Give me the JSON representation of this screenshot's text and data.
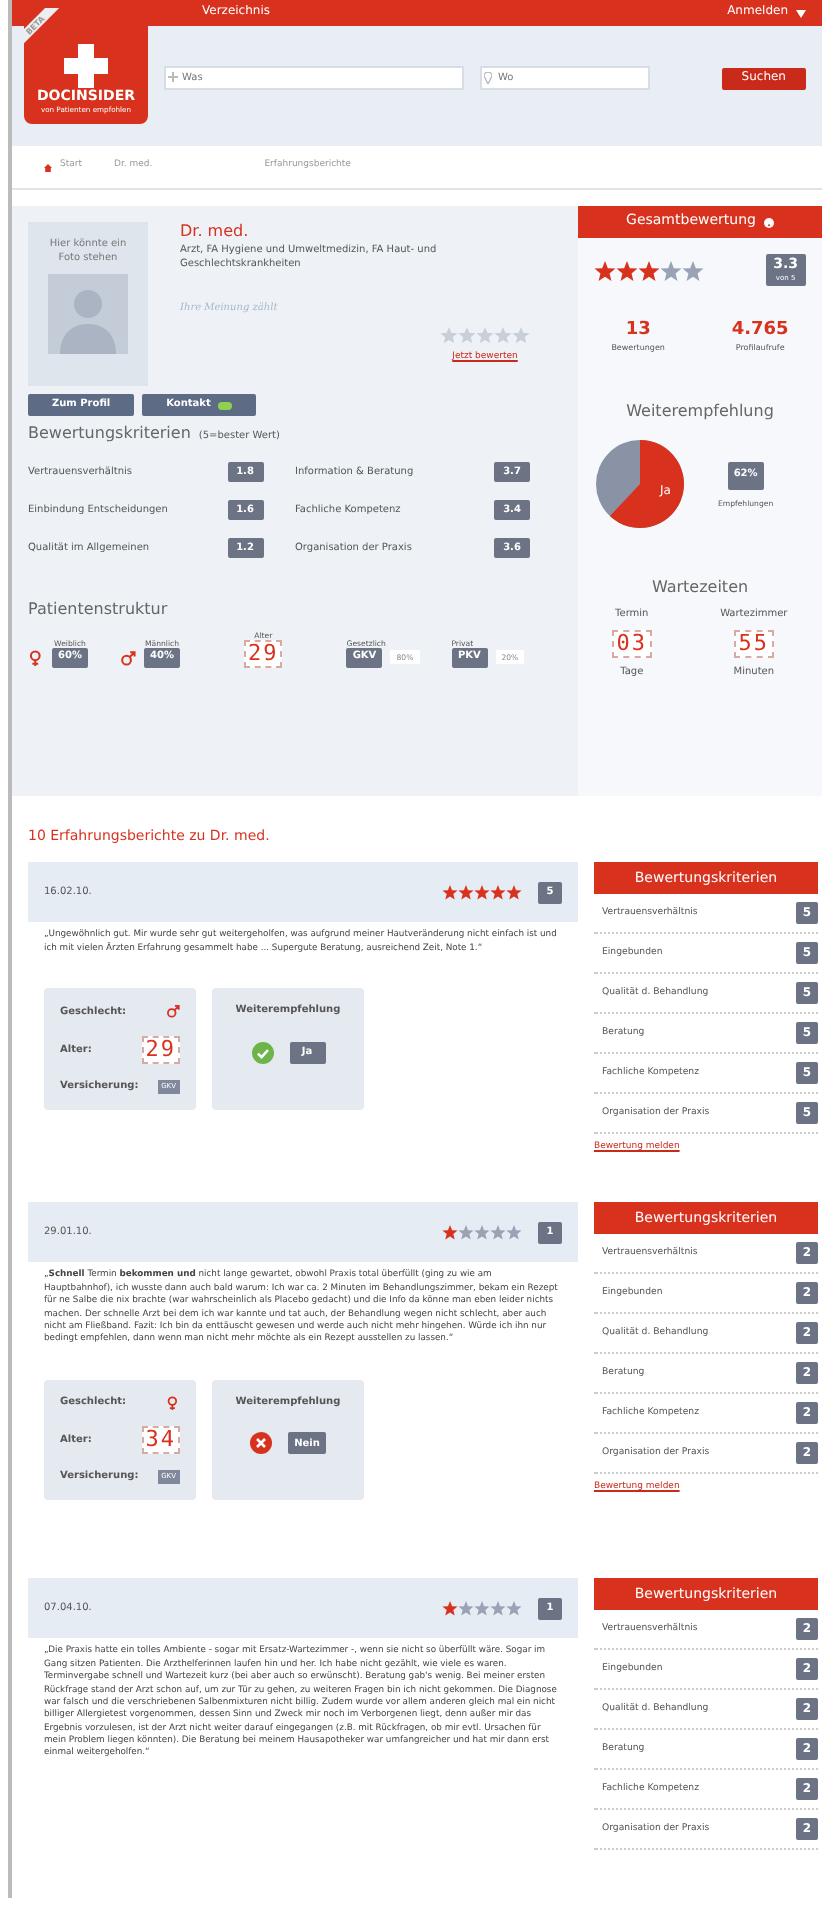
{
  "nav": {
    "links": [
      {
        "label": "Verzeichnis"
      }
    ],
    "login": "Anmelden"
  },
  "logo": {
    "ribbon": "BETA",
    "name": "DOCINSIDER",
    "tagline": "von Patienten empfohlen"
  },
  "search": {
    "what": {
      "placeholder": "Was"
    },
    "where": {
      "placeholder": "Wo"
    },
    "button": "Suchen"
  },
  "breadcrumb": [
    "Start",
    "Dr. med.",
    "Erfahrungsberichte"
  ],
  "profile": {
    "photo_text": "Hier könnte ein Foto stehen",
    "title": "Dr. med.",
    "specialty": "Arzt, FA Hygiene und Umweltmedizin, FA Haut- und Geschlechtskrankheiten",
    "prompt": "Ihre Meinung zählt",
    "stars": 0,
    "rate_link": "Jetzt bewerten",
    "buttons": [
      {
        "label": "Zum Profil",
        "kind": "plain"
      },
      {
        "label": "Kontakt",
        "kind": "contact"
      }
    ]
  },
  "criteria": {
    "title": "Bewertungskriterien",
    "note": "(5=bester Wert)",
    "items": [
      {
        "label": "Vertrauensverhältnis",
        "score": "1.8"
      },
      {
        "label": "Information & Beratung",
        "score": "3.7"
      },
      {
        "label": "Einbindung Entscheidungen",
        "score": "1.6"
      },
      {
        "label": "Fachliche Kompetenz",
        "score": "3.4"
      },
      {
        "label": "Qualität im Allgemeinen",
        "score": "1.2"
      },
      {
        "label": "Organisation der Praxis",
        "score": "3.6"
      }
    ]
  },
  "patients": {
    "title": "Patientenstruktur",
    "gender": [
      {
        "kind": "female",
        "label": "Weiblich",
        "value": "60%"
      },
      {
        "kind": "male",
        "label": "Männlich",
        "value": "40%"
      }
    ],
    "age": {
      "label": "Alter",
      "value": "29"
    },
    "insurance": [
      {
        "label": "Gesetzlich",
        "code": "GKV",
        "value": "80%"
      },
      {
        "label": "Privat",
        "code": "PKV",
        "value": "20%"
      }
    ]
  },
  "overall": {
    "title": "Gesamtbewertung",
    "stars": 3,
    "score": "3.3",
    "scale": "von 5",
    "stats": [
      {
        "value": "13",
        "label": "Bewertungen"
      },
      {
        "value": "4.765",
        "label": "Profilaufrufe"
      }
    ]
  },
  "recommend": {
    "title": "Weiterempfehlung",
    "slice_label": "Ja",
    "value": "62%",
    "label": "Empfehlungen"
  },
  "waits": {
    "title": "Wartezeiten",
    "items": [
      {
        "label": "Termin",
        "value": "03",
        "unit": "Tage"
      },
      {
        "label": "Wartezimmer",
        "value": "55",
        "unit": "Minuten"
      }
    ]
  },
  "reviews_title": "10 Erfahrungsberichte zu Dr. med.",
  "reviews": [
    {
      "date": "16.02.10.",
      "stars": 5,
      "score": "5",
      "text": "„Ungewöhnlich gut. Mir wurde sehr gut weitergeholfen, was aufgrund meiner Hautveränderung nicht einfach ist und ich mit vielen Ärzten Erfahrung gesammelt habe ... Supergute Beratung, ausreichend Zeit, Note 1.“",
      "details": {
        "kind": "male",
        "gender_label": "Geschlecht:",
        "age_label": "Alter:",
        "age": "29",
        "insurance_label": "Versicherung:",
        "insurance": "GKV"
      },
      "recommendation": {
        "title": "Weiterempfehlung",
        "recommended": true,
        "answer": "Ja"
      },
      "criteria_title": "Bewertungskriterien",
      "criteria": [
        {
          "label": "Vertrauensverhältnis",
          "score": "5"
        },
        {
          "label": "Eingebunden",
          "score": "5"
        },
        {
          "label": "Qualität d. Behandlung",
          "score": "5"
        },
        {
          "label": "Beratung",
          "score": "5"
        },
        {
          "label": "Fachliche Kompetenz",
          "score": "5"
        },
        {
          "label": "Organisation der Praxis",
          "score": "5"
        }
      ],
      "report": "Bewertung melden"
    },
    {
      "date": "29.01.10.",
      "stars": 1,
      "score": "1",
      "text": "„**Schnell** Termin **bekommen und** nicht lange gewartet, obwohl Praxis total überfüllt (ging zu wie am Hauptbahnhof), ich wusste dann auch bald warum: Ich war ca. 2 Minuten im Behandlungszimmer, bekam ein Rezept für ne Salbe die nix brachte (war wahrscheinlich als Placebo gedacht) und die Info da könne man eben leider nichts machen. Der schnelle Arzt bei dem ich war kannte und tat auch, der Behandlung wegen nicht schlecht, aber auch nicht am Fließband. Fazit: Ich bin da enttäuscht gewesen und werde auch nicht mehr hingehen. Würde ich ihn nur bedingt empfehlen, dann wenn man nicht mehr möchte als ein Rezept ausstellen zu lassen.“",
      "details": {
        "kind": "female",
        "gender_label": "Geschlecht:",
        "age_label": "Alter:",
        "age": "34",
        "insurance_label": "Versicherung:",
        "insurance": "GKV"
      },
      "recommendation": {
        "title": "Weiterempfehlung",
        "recommended": false,
        "answer": "Nein"
      },
      "criteria_title": "Bewertungskriterien",
      "criteria": [
        {
          "label": "Vertrauensverhältnis",
          "score": "2"
        },
        {
          "label": "Eingebunden",
          "score": "2"
        },
        {
          "label": "Qualität d. Behandlung",
          "score": "2"
        },
        {
          "label": "Beratung",
          "score": "2"
        },
        {
          "label": "Fachliche Kompetenz",
          "score": "2"
        },
        {
          "label": "Organisation der Praxis",
          "score": "2"
        }
      ],
      "report": "Bewertung melden"
    },
    {
      "date": "07.04.10.",
      "stars": 1,
      "score": "1",
      "text": "„Die Praxis hatte ein tolles Ambiente - sogar mit Ersatz-Wartezimmer -, wenn sie nicht so überfüllt wäre. Sogar im Gang sitzen Patienten. Die Arzthelferinnen laufen hin und her. Ich habe nicht gezählt, wie viele es waren. Terminvergabe schnell und Wartezeit kurz (bei aber auch so erwünscht). Beratung gab's wenig. Bei meiner ersten Rückfrage stand der Arzt schon auf, um zur Tür zu gehen, zu weiteren Fragen bin ich nicht gekommen. Die Diagnose war falsch und die verschriebenen Salbenmixturen nicht billig. Zudem wurde vor allem anderen gleich mal ein nicht billiger Allergietest vorgenommen, dessen Sinn und Zweck mir noch im Verborgenen liegt, denn außer mir das Ergebnis vorzulesen, ist der Arzt nicht weiter darauf eingegangen (z.B. mit Rückfragen, ob mir evtl. Ursachen für mein Problem liegen könnten). Die Beratung bei meinem Hausapotheker war umfangreicher und hat mir dann erst einmal weitergeholfen.“",
      "criteria_title": "Bewertungskriterien",
      "criteria": [
        {
          "label": "Vertrauensverhältnis",
          "score": "2"
        },
        {
          "label": "Eingebunden",
          "score": "2"
        },
        {
          "label": "Qualität d. Behandlung",
          "score": "2"
        },
        {
          "label": "Beratung",
          "score": "2"
        },
        {
          "label": "Fachliche Kompetenz",
          "score": "2"
        },
        {
          "label": "Organisation der Praxis",
          "score": "2"
        }
      ]
    }
  ]
}
